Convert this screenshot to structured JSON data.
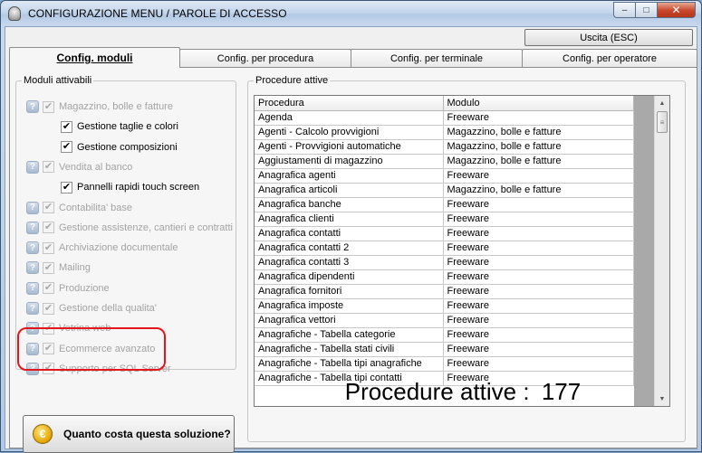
{
  "window": {
    "title": "CONFIGURAZIONE MENU / PAROLE DI ACCESSO",
    "minimize_glyph": "–",
    "restore_glyph": "□",
    "close_glyph": "✕"
  },
  "toolbar": {
    "exit_label": "Uscita (ESC)"
  },
  "tabs": [
    {
      "label": "Config. moduli",
      "active": true
    },
    {
      "label": "Config. per procedura",
      "active": false
    },
    {
      "label": "Config. per terminale",
      "active": false
    },
    {
      "label": "Config. per operatore",
      "active": false
    }
  ],
  "modules": {
    "title": "Moduli attivabili",
    "info_glyph": "?",
    "check_glyph": "✔",
    "items": [
      {
        "label": "Magazzino, bolle e fatture",
        "level": 0,
        "enabled": false,
        "checked": true
      },
      {
        "label": "Gestione taglie e colori",
        "level": 1,
        "enabled": true,
        "checked": true
      },
      {
        "label": "Gestione composizioni",
        "level": 1,
        "enabled": true,
        "checked": true
      },
      {
        "label": "Vendita al banco",
        "level": 0,
        "enabled": false,
        "checked": true
      },
      {
        "label": "Pannelli rapidi touch screen",
        "level": 1,
        "enabled": true,
        "checked": true
      },
      {
        "label": "Contabilita' base",
        "level": 0,
        "enabled": false,
        "checked": true
      },
      {
        "label": "Gestione assistenze, cantieri e contratti",
        "level": 0,
        "enabled": false,
        "checked": true
      },
      {
        "label": "Archiviazione documentale",
        "level": 0,
        "enabled": false,
        "checked": true
      },
      {
        "label": "Mailing",
        "level": 0,
        "enabled": false,
        "checked": true
      },
      {
        "label": "Produzione",
        "level": 0,
        "enabled": false,
        "checked": true
      },
      {
        "label": "Gestione della qualita'",
        "level": 0,
        "enabled": false,
        "checked": true
      },
      {
        "label": "Vetrina web",
        "level": 0,
        "enabled": false,
        "checked": true
      },
      {
        "label": "Ecommerce avanzato",
        "level": 0,
        "enabled": false,
        "checked": true
      },
      {
        "label": "Supporto per SQL Server",
        "level": 0,
        "enabled": false,
        "checked": true
      }
    ]
  },
  "cost_button": {
    "label": "Quanto costa questa soluzione?",
    "icon_glyph": "€"
  },
  "procedures": {
    "title": "Procedure attive",
    "columns": [
      "Procedura",
      "Modulo"
    ],
    "rows": [
      [
        "Agenda",
        "Freeware"
      ],
      [
        "Agenti - Calcolo provvigioni",
        "Magazzino, bolle e fatture"
      ],
      [
        "Agenti - Provvigioni automatiche",
        "Magazzino, bolle e fatture"
      ],
      [
        "Aggiustamenti di magazzino",
        "Magazzino, bolle e fatture"
      ],
      [
        "Anagrafica agenti",
        "Freeware"
      ],
      [
        "Anagrafica articoli",
        "Magazzino, bolle e fatture"
      ],
      [
        "Anagrafica banche",
        "Freeware"
      ],
      [
        "Anagrafica clienti",
        "Freeware"
      ],
      [
        "Anagrafica contatti",
        "Freeware"
      ],
      [
        "Anagrafica contatti 2",
        "Freeware"
      ],
      [
        "Anagrafica contatti 3",
        "Freeware"
      ],
      [
        "Anagrafica dipendenti",
        "Freeware"
      ],
      [
        "Anagrafica fornitori",
        "Freeware"
      ],
      [
        "Anagrafica imposte",
        "Freeware"
      ],
      [
        "Anagrafica vettori",
        "Freeware"
      ],
      [
        "Anagrafiche - Tabella categorie",
        "Freeware"
      ],
      [
        "Anagrafiche - Tabella stati civili",
        "Freeware"
      ],
      [
        "Anagrafiche - Tabella tipi anagrafiche",
        "Freeware"
      ],
      [
        "Anagrafiche - Tabella tipi contatti",
        "Freeware"
      ]
    ],
    "scroll_up_glyph": "▲",
    "scroll_down_glyph": "▼",
    "thumb_glyph": "≡",
    "count_label": "Procedure attive :",
    "count_value": "177"
  },
  "colors": {
    "highlight": "#e3161c",
    "title_gradient": "#c4d6ec",
    "disabled_text": "#a3a3a3"
  }
}
